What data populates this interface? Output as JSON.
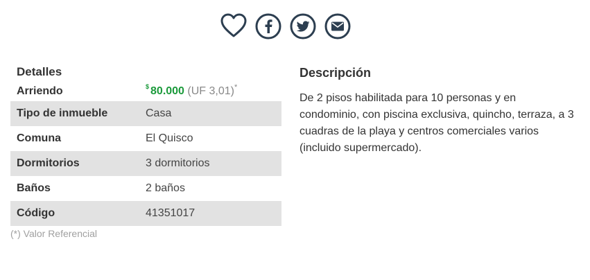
{
  "share": [
    {
      "name": "favorite",
      "icon": "heart-icon"
    },
    {
      "name": "facebook",
      "icon": "facebook-icon"
    },
    {
      "name": "twitter",
      "icon": "twitter-icon"
    },
    {
      "name": "email",
      "icon": "email-icon"
    }
  ],
  "colors": {
    "icon": "#2c3e50",
    "price": "#1b9a3b",
    "row_shade": "#e2e2e2"
  },
  "details": {
    "title": "Detalles",
    "price": {
      "label": "Arriendo",
      "currency": "$",
      "amount": "80.000",
      "uf": "(UF 3,01)",
      "asterisk": "*"
    },
    "rows": [
      {
        "label": "Tipo de inmueble",
        "value": "Casa"
      },
      {
        "label": "Comuna",
        "value": "El Quisco"
      },
      {
        "label": "Dormitorios",
        "value": "3 dormitorios"
      },
      {
        "label": "Baños",
        "value": "2 baños"
      },
      {
        "label": "Código",
        "value": "41351017"
      }
    ],
    "footnote": "(*) Valor Referencial"
  },
  "description": {
    "title": "Descripción",
    "text": "De 2 pisos habilitada para 10 personas y en condominio, con piscina exclusiva, quincho, terraza, a 3 cuadras de la playa y centros comerciales varios (incluido supermercado)."
  }
}
